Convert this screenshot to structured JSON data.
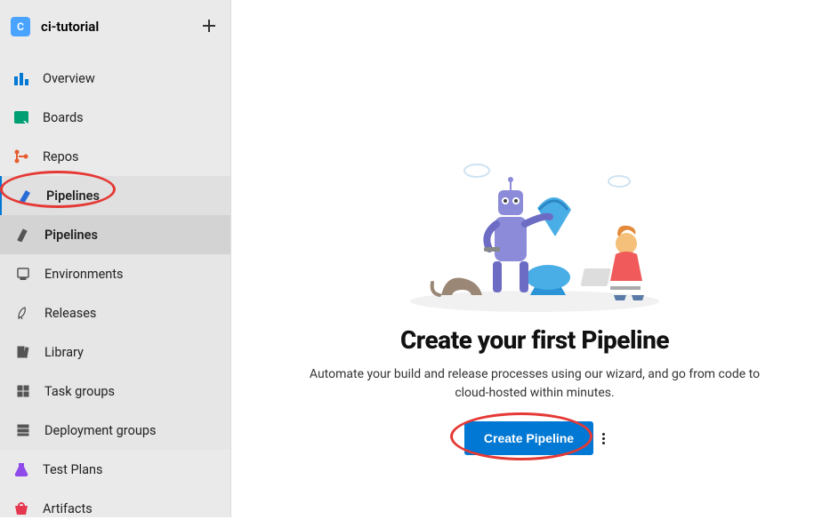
{
  "project": {
    "badge": "C",
    "name": "ci-tutorial"
  },
  "sidebar": {
    "items": [
      {
        "label": "Overview"
      },
      {
        "label": "Boards"
      },
      {
        "label": "Repos"
      },
      {
        "label": "Pipelines"
      },
      {
        "label": "Test Plans"
      },
      {
        "label": "Artifacts"
      }
    ],
    "pipelines_sub": [
      {
        "label": "Pipelines"
      },
      {
        "label": "Environments"
      },
      {
        "label": "Releases"
      },
      {
        "label": "Library"
      },
      {
        "label": "Task groups"
      },
      {
        "label": "Deployment groups"
      }
    ]
  },
  "main": {
    "title": "Create your first Pipeline",
    "description": "Automate your build and release processes using our wizard, and go from code to cloud-hosted within minutes.",
    "cta_label": "Create Pipeline"
  },
  "colors": {
    "primary": "#0078d4",
    "annotation": "#e53935"
  }
}
